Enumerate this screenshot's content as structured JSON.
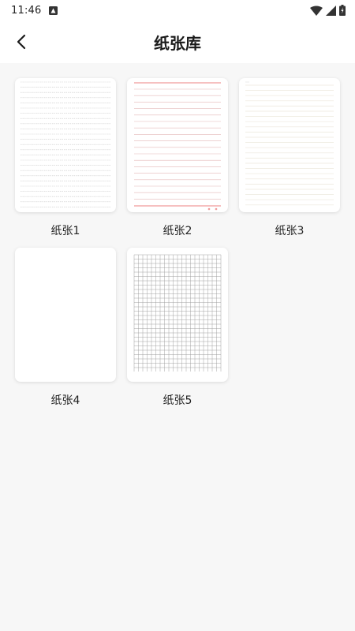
{
  "status_bar": {
    "time": "11:46"
  },
  "header": {
    "title": "纸张库"
  },
  "papers": [
    {
      "label": "纸张1",
      "style": "double-lined"
    },
    {
      "label": "纸张2",
      "style": "red-lined"
    },
    {
      "label": "纸张3",
      "style": "faint-lined"
    },
    {
      "label": "纸张4",
      "style": "blank"
    },
    {
      "label": "纸张5",
      "style": "grid"
    }
  ],
  "colors": {
    "background": "#f7f7f7",
    "bar": "#ffffff",
    "red_line": "#f2a3a3",
    "gray_line": "#c8c8c8"
  }
}
